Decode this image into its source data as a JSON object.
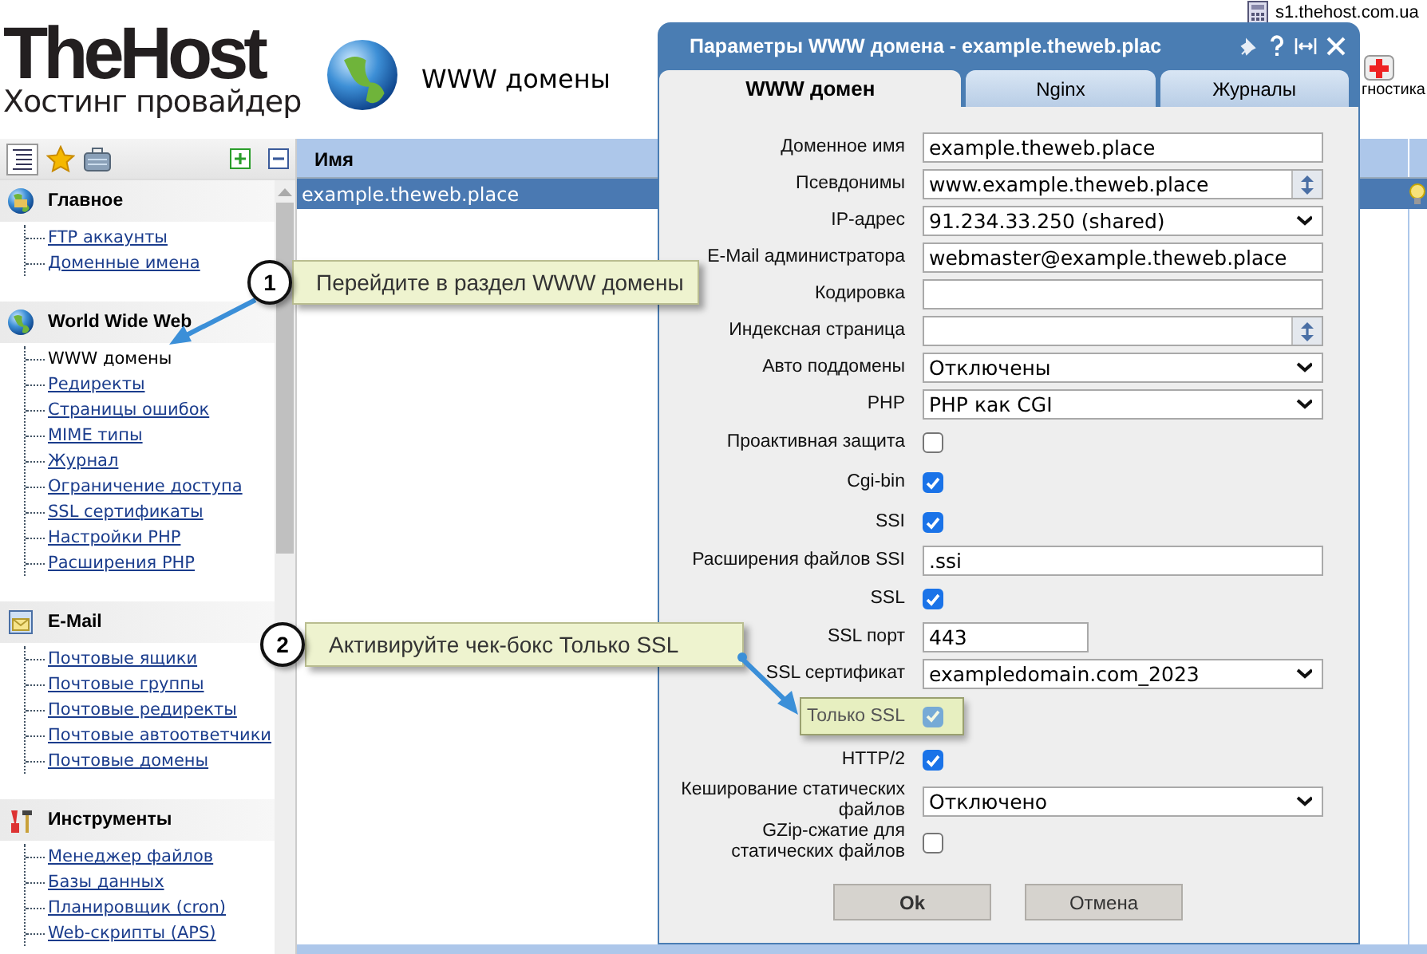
{
  "header": {
    "logo_title": "TheHost",
    "logo_subtitle": "Хостинг провайдер",
    "page_title": "WWW домены",
    "server": "s1.thehost.com.ua",
    "toolbar_item": "гностика"
  },
  "sidebar": {
    "sections": [
      {
        "kind": "home",
        "title": "Главное",
        "items": [
          {
            "label": "FTP аккаунты",
            "selected": false
          },
          {
            "label": "Доменные имена",
            "selected": false
          }
        ]
      },
      {
        "kind": "web",
        "title": "World Wide Web",
        "items": [
          {
            "label": "WWW домены",
            "selected": true
          },
          {
            "label": "Редиректы",
            "selected": false
          },
          {
            "label": "Страницы ошибок",
            "selected": false
          },
          {
            "label": "MIME типы",
            "selected": false
          },
          {
            "label": "Журнал",
            "selected": false
          },
          {
            "label": "Ограничение доступа",
            "selected": false
          },
          {
            "label": "SSL сертификаты",
            "selected": false
          },
          {
            "label": "Настройки PHP",
            "selected": false
          },
          {
            "label": "Расширения PHP",
            "selected": false
          }
        ]
      },
      {
        "kind": "mail",
        "title": "E-Mail",
        "items": [
          {
            "label": "Почтовые ящики",
            "selected": false
          },
          {
            "label": "Почтовые группы",
            "selected": false
          },
          {
            "label": "Почтовые редиректы",
            "selected": false
          },
          {
            "label": "Почтовые автоответчики",
            "selected": false
          },
          {
            "label": "Почтовые домены",
            "selected": false
          }
        ]
      },
      {
        "kind": "tools",
        "title": "Инструменты",
        "items": [
          {
            "label": "Менеджер файлов",
            "selected": false
          },
          {
            "label": "Базы данных",
            "selected": false
          },
          {
            "label": "Планировщик (cron)",
            "selected": false
          },
          {
            "label": "Web-скрипты (APS)",
            "selected": false
          }
        ]
      }
    ]
  },
  "table": {
    "columns": [
      "Имя"
    ],
    "rows": [
      {
        "name": "example.theweb.place",
        "selected": true
      }
    ]
  },
  "dialog": {
    "title": "Параметры WWW домена - example.theweb.plac",
    "tabs": [
      {
        "label": "WWW домен",
        "selected": true
      },
      {
        "label": "Nginx",
        "selected": false
      },
      {
        "label": "Журналы",
        "selected": false
      }
    ],
    "fields": [
      {
        "kind": "text",
        "label": "Доменное имя",
        "value": "example.theweb.place",
        "highlighted": false
      },
      {
        "kind": "combo",
        "label": "Псевдонимы",
        "value": "www.example.theweb.place",
        "highlighted": false
      },
      {
        "kind": "select",
        "label": "IP-адрес",
        "value": "91.234.33.250 (shared)",
        "highlighted": false
      },
      {
        "kind": "text",
        "label": "E-Mail администратора",
        "value": "webmaster@example.theweb.place",
        "highlighted": false
      },
      {
        "kind": "text",
        "label": "Кодировка",
        "highlighted": false
      },
      {
        "kind": "combo",
        "label": "Индексная страница",
        "highlighted": false
      },
      {
        "kind": "select",
        "label": "Авто поддомены",
        "value": "Отключены",
        "highlighted": false
      },
      {
        "kind": "select",
        "label": "PHP",
        "value": "PHP как CGI",
        "highlighted": false
      },
      {
        "kind": "checkbox",
        "label": "Проактивная защита",
        "checked": false,
        "highlighted": false
      },
      {
        "kind": "checkbox",
        "label": "Cgi-bin",
        "checked": true,
        "highlighted": false
      },
      {
        "kind": "checkbox",
        "label": "SSI",
        "checked": true,
        "highlighted": false
      },
      {
        "kind": "text",
        "label": "Расширения файлов SSI",
        "value": ".ssi",
        "highlighted": false
      },
      {
        "kind": "checkbox",
        "label": "SSL",
        "checked": true,
        "highlighted": false
      },
      {
        "kind": "short",
        "label": "SSL порт",
        "value": "443",
        "highlighted": false
      },
      {
        "kind": "select",
        "label": "SSL сертификат",
        "value": "exampledomain.com_2023",
        "highlighted": false
      },
      {
        "kind": "checkbox",
        "label": "Только SSL",
        "checked": true,
        "highlighted": true
      },
      {
        "kind": "checkbox",
        "label": "HTTP/2",
        "checked": true,
        "highlighted": false
      },
      {
        "kind": "select",
        "label": "Кеширование статических файлов",
        "value": "Отключено",
        "highlighted": false
      },
      {
        "kind": "checkbox",
        "label": "GZip-сжатие для статических файлов",
        "checked": false,
        "highlighted": false
      }
    ],
    "buttons": [
      "Ok",
      "Отмена"
    ]
  },
  "callouts": [
    {
      "number": "1",
      "text": "Перейдите в раздел WWW домены"
    },
    {
      "number": "2",
      "text": "Активируйте чек-бокс Только SSL"
    }
  ]
}
